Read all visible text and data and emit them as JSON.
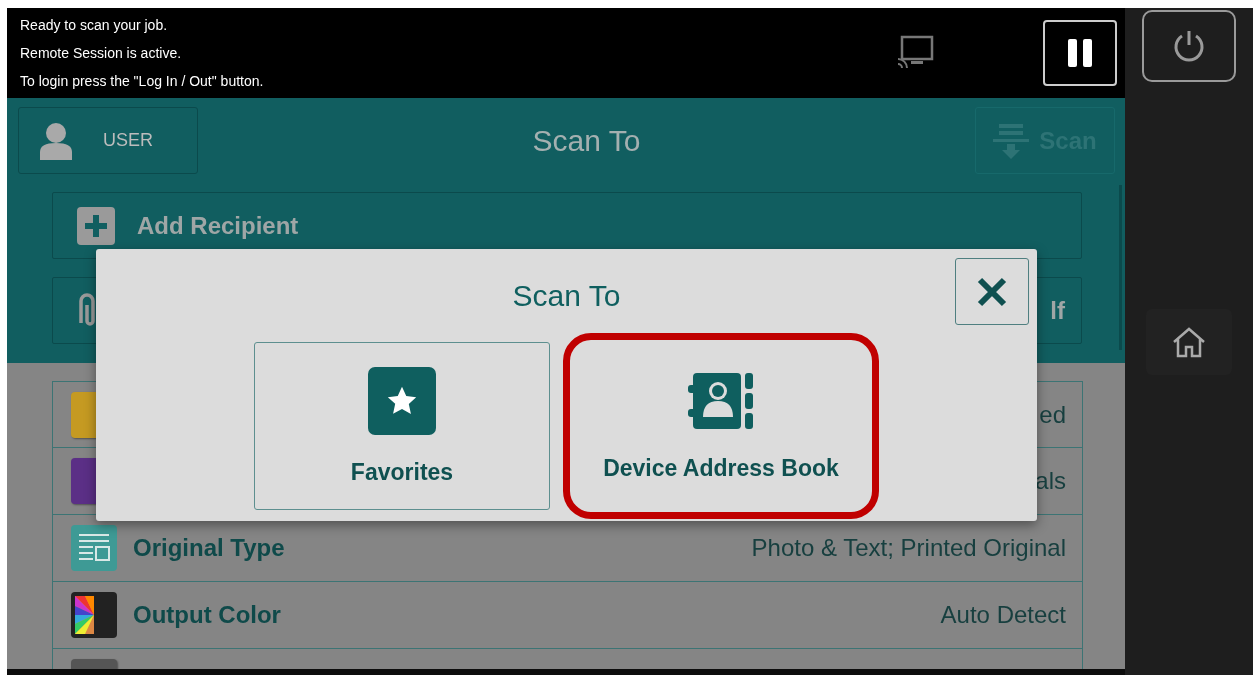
{
  "status_bar": {
    "messages": [
      "Ready to scan your job.",
      "Remote Session is active.",
      "To login press the \"Log In / Out\" button."
    ]
  },
  "header": {
    "user_button": "USER",
    "title": "Scan To",
    "scan_button": {
      "label": "Scan",
      "disabled": true
    }
  },
  "recipient_rows": [
    {
      "kind": "add",
      "label": "Add Recipient"
    },
    {
      "kind": "attachment",
      "value": "lf"
    }
  ],
  "settings": [
    {
      "kind": "page",
      "value": "ed"
    },
    {
      "kind": "monitor",
      "value": "als"
    },
    {
      "kind": "original",
      "label": "Original Type",
      "value": "Photo & Text; Printed Original"
    },
    {
      "kind": "color",
      "label": "Output Color",
      "value": "Auto Detect"
    },
    {
      "kind": "partial"
    }
  ],
  "dialog": {
    "title": "Scan To",
    "options": [
      {
        "kind": "favorites",
        "label": "Favorites",
        "highlighted": false
      },
      {
        "kind": "address_book",
        "label": "Device Address Book",
        "highlighted": true
      }
    ]
  }
}
